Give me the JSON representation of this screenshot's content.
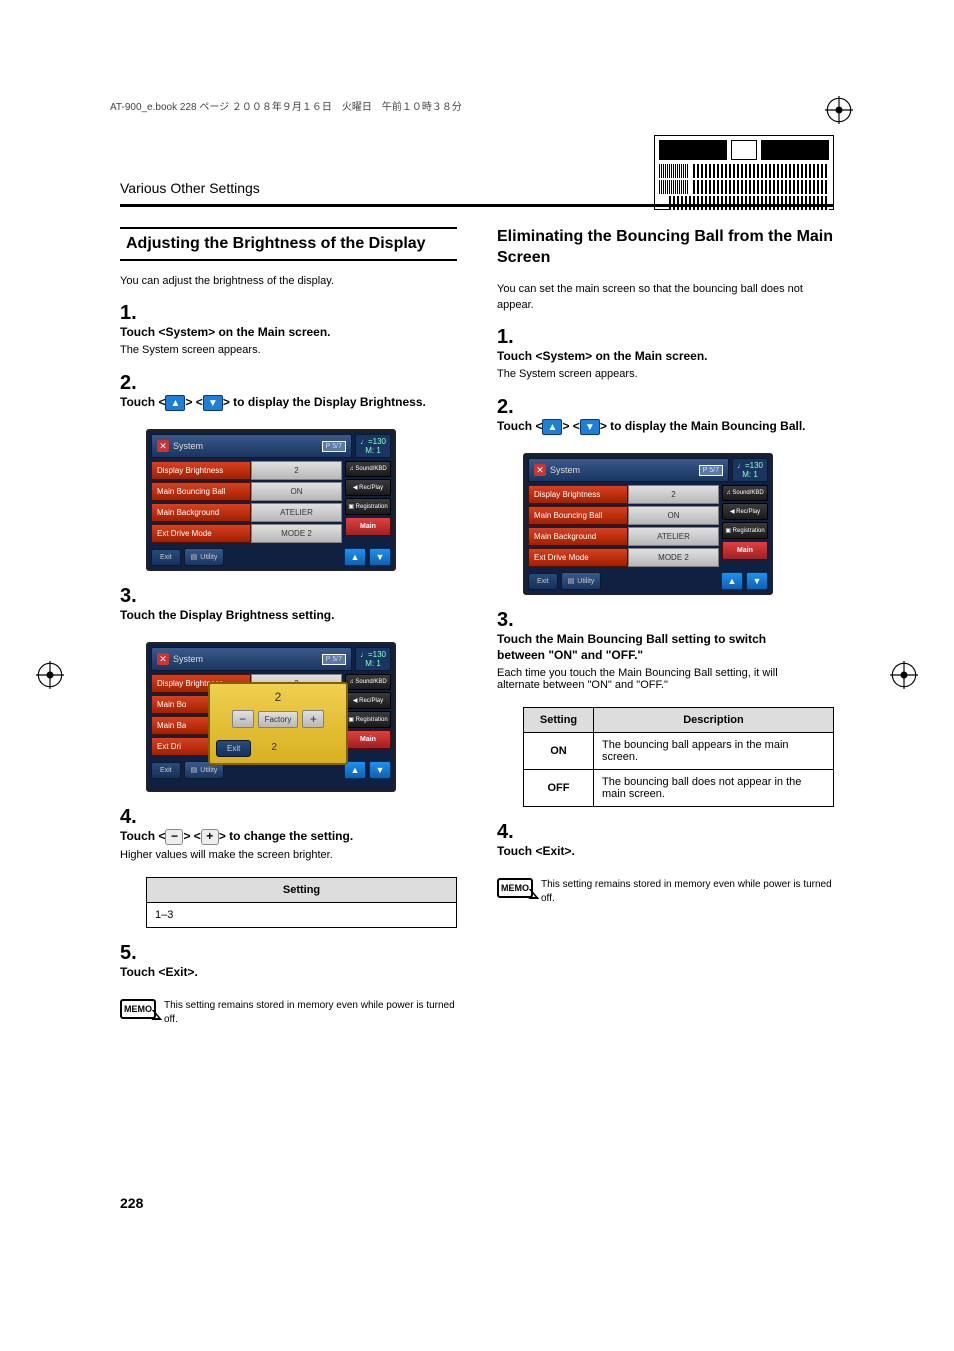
{
  "header_line": "AT-900_e.book  228 ページ  ２００８年９月１６日　火曜日　午前１０時３８分",
  "chapter": "Various Other Settings",
  "page_number": "228",
  "left": {
    "heading": "Adjusting the Brightness of the Display",
    "intro": "You can adjust the brightness of the display.",
    "steps": [
      {
        "num": "1.",
        "title": "Touch <System> on the Main screen.",
        "sub": "The System screen appears."
      },
      {
        "num": "2.",
        "title_pre": "Touch <",
        "title_mid": "> <",
        "title_post": "> to display the Display Brightness."
      },
      {
        "num": "3.",
        "title": "Touch the Display Brightness setting."
      },
      {
        "num": "4.",
        "title_pre": "Touch <",
        "title_mid": "> <",
        "title_post": "> to change the setting.",
        "sub": "Higher values will make the screen brighter."
      },
      {
        "num": "5.",
        "title": "Touch <Exit>."
      }
    ],
    "table": {
      "header": "Setting",
      "value": "1–3"
    },
    "memo": "This setting remains stored in memory even while power is turned off."
  },
  "right": {
    "heading": "Eliminating the Bouncing Ball from the Main Screen",
    "intro": "You can set the main screen so that the bouncing ball does not appear.",
    "steps": [
      {
        "num": "1.",
        "title": "Touch <System> on the Main screen.",
        "sub": "The System screen appears."
      },
      {
        "num": "2.",
        "title_pre": "Touch <",
        "title_mid": "> <",
        "title_post": "> to display the Main Bouncing Ball."
      },
      {
        "num": "3.",
        "title": "Touch the Main Bouncing Ball setting to switch between \"ON\" and \"OFF.\"",
        "sub": "Each time you touch the Main Bouncing Ball setting, it will alternate between \"ON\" and \"OFF.\""
      },
      {
        "num": "4.",
        "title": "Touch <Exit>."
      }
    ],
    "table": {
      "headers": [
        "Setting",
        "Description"
      ],
      "rows": [
        {
          "k": "ON",
          "v": "The bouncing ball appears in the main screen."
        },
        {
          "k": "OFF",
          "v": "The bouncing ball does not appear in the main screen."
        }
      ]
    },
    "memo": "This setting remains stored in memory even while power is turned off."
  },
  "screenshot": {
    "title": "System",
    "page_ind": "P 5/7",
    "tempo": {
      "line1": "♩=130",
      "line2": "M:    1"
    },
    "params": [
      {
        "label": "Display Brightness",
        "value": "2"
      },
      {
        "label": "Main Bouncing Ball",
        "value": "ON"
      },
      {
        "label": "Main Background",
        "value": "ATELIER"
      },
      {
        "label": "Ext Drive Mode",
        "value": "MODE 2"
      }
    ],
    "side_buttons": [
      "♫ Sound/KBD",
      "◀ Rec/Play",
      "▣ Registration"
    ],
    "main_btn": "Main",
    "exit": "Exit",
    "utility": "Utility",
    "popup": {
      "value": "2",
      "factory": "Factory",
      "exit": "Exit",
      "value2": "2"
    }
  }
}
